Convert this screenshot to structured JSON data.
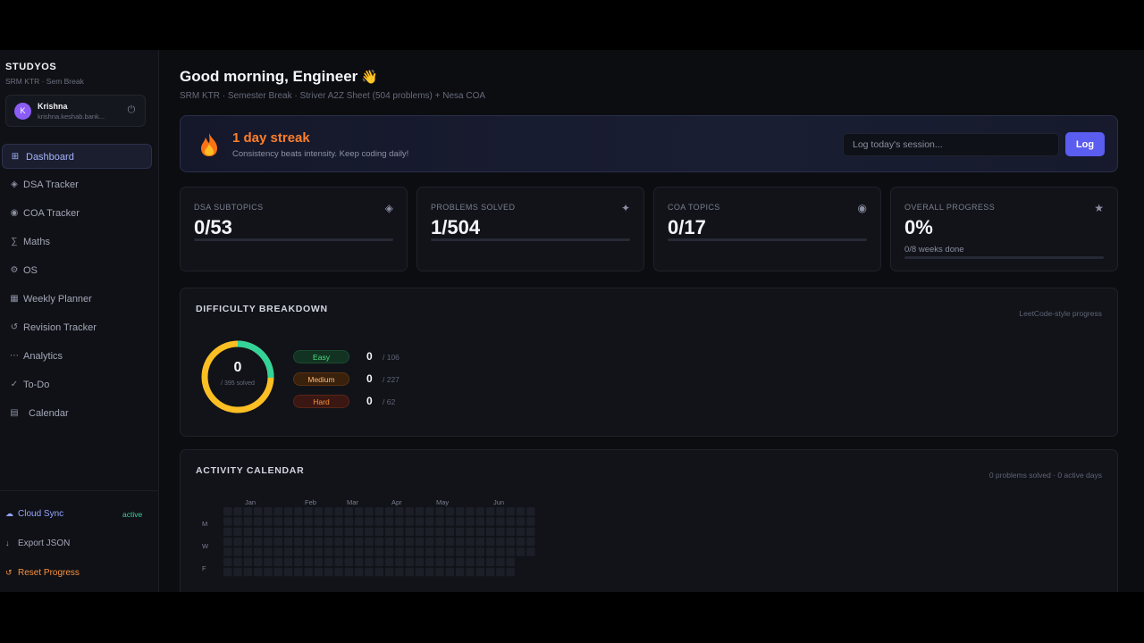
{
  "sidebar": {
    "brand": "STUDYOS",
    "brand_sub": "SRM KTR · Sem Break",
    "user": {
      "initial": "K",
      "name": "Krishna",
      "email": "krishna.keshab.bank..."
    },
    "items": [
      {
        "label": "Dashboard",
        "icon": "grid-icon"
      },
      {
        "label": "DSA Tracker",
        "icon": "diamond-icon"
      },
      {
        "label": "COA Tracker",
        "icon": "circle-icon"
      },
      {
        "label": "Maths",
        "icon": "sigma-icon"
      },
      {
        "label": "OS",
        "icon": "gear-icon"
      },
      {
        "label": "Weekly Planner",
        "icon": "table-icon"
      },
      {
        "label": "Revision Tracker",
        "icon": "refresh-icon"
      },
      {
        "label": "Analytics",
        "icon": "dots-icon"
      },
      {
        "label": "To-Do",
        "icon": "check-icon"
      },
      {
        "label": "Calendar",
        "icon": "calendar-icon"
      }
    ],
    "footer": {
      "cloud_sync": "Cloud Sync",
      "sync_status": "active",
      "export": "Export JSON",
      "reset": "Reset Progress"
    }
  },
  "header": {
    "greeting": "Good morning, Engineer",
    "wave": "👋",
    "subtitle": "SRM KTR · Semester Break · Striver A2Z Sheet (504 problems) + Nesa COA"
  },
  "streak": {
    "title": "1 day streak",
    "subtitle": "Consistency beats intensity. Keep coding daily!",
    "input_placeholder": "Log today's session...",
    "button": "Log"
  },
  "stats": [
    {
      "label": "DSA SUBTOPICS",
      "value": "0/53",
      "icon": "diamond-icon",
      "progress": 0
    },
    {
      "label": "PROBLEMS SOLVED",
      "value": "1/504",
      "icon": "sparkle-icon",
      "progress": 0.002
    },
    {
      "label": "COA TOPICS",
      "value": "0/17",
      "icon": "target-icon",
      "progress": 0
    },
    {
      "label": "OVERALL PROGRESS",
      "value": "0%",
      "note": "0/8 weeks done",
      "icon": "star-icon",
      "progress": 0
    }
  ],
  "difficulty": {
    "title": "DIFFICULTY BREAKDOWN",
    "note": "LeetCode-style progress",
    "center_value": "0",
    "center_sub": "/ 395 solved",
    "levels": [
      {
        "name": "Easy",
        "count": "0",
        "total": "/ 106",
        "color": "#34d399"
      },
      {
        "name": "Medium",
        "count": "0",
        "total": "/ 227",
        "color": "#fbbf24"
      },
      {
        "name": "Hard",
        "count": "0",
        "total": "/ 62",
        "color": "#f87171"
      }
    ]
  },
  "activity": {
    "title": "ACTIVITY CALENDAR",
    "note": "0 problems solved · 0 active days",
    "months": [
      "Jan",
      "Feb",
      "Mar",
      "Apr",
      "May",
      "Jun"
    ],
    "days": [
      "M",
      "W",
      "F"
    ]
  }
}
